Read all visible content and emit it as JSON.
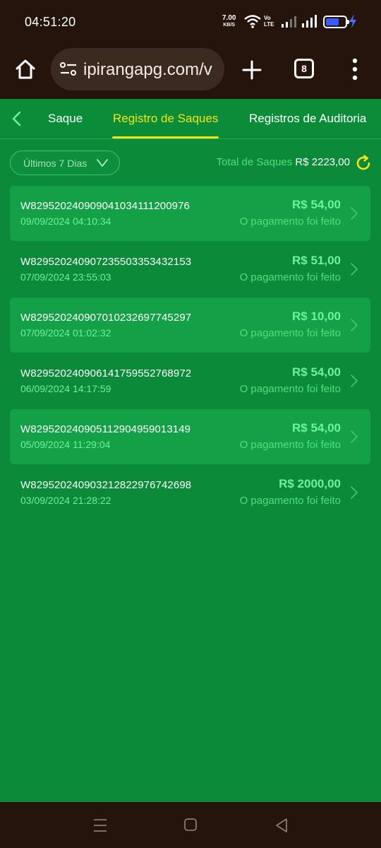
{
  "status": {
    "time": "04:51:20",
    "net_speed": "7.00",
    "net_unit": "KB/S",
    "volte_top": "Vo",
    "volte_bottom": "LTE",
    "icons": [
      "wifi-icon",
      "volte-icon",
      "signal-icon",
      "signal-icon",
      "battery-icon",
      "charging-icon"
    ]
  },
  "browser": {
    "url": "ipirangapg.com/v",
    "tab_count": "8",
    "icons": [
      "home-icon",
      "site-settings-icon",
      "plus-icon",
      "tab-switcher-icon",
      "more-vert-icon"
    ]
  },
  "nav": {
    "back_icon": "chevron-left-icon",
    "tabs": [
      {
        "label": "Saque",
        "active": false
      },
      {
        "label": "Registro de Saques",
        "active": true
      },
      {
        "label": "Registros de Auditoria",
        "active": false
      }
    ]
  },
  "filter": {
    "label": "Últimos 7 Dias",
    "icon": "chevron-down-icon"
  },
  "summary": {
    "label": "Total de Saques",
    "amount": "R$ 2223,00",
    "icon": "refresh-icon"
  },
  "records": [
    {
      "id": "W829520240909041034111200976",
      "date": "09/09/2024 04:10:34",
      "amount": "R$ 54,00",
      "status": "O pagamento foi feito"
    },
    {
      "id": "W829520240907235503353432153",
      "date": "07/09/2024 23:55:03",
      "amount": "R$ 51,00",
      "status": "O pagamento foi feito"
    },
    {
      "id": "W829520240907010232697745297",
      "date": "07/09/2024 01:02:32",
      "amount": "R$ 10,00",
      "status": "O pagamento foi feito"
    },
    {
      "id": "W829520240906141759552768972",
      "date": "06/09/2024 14:17:59",
      "amount": "R$ 54,00",
      "status": "O pagamento foi feito"
    },
    {
      "id": "W829520240905112904959013149",
      "date": "05/09/2024 11:29:04",
      "amount": "R$ 54,00",
      "status": "O pagamento foi feito"
    },
    {
      "id": "W829520240903212822976742698",
      "date": "03/09/2024 21:28:22",
      "amount": "R$ 2000,00",
      "status": "O pagamento foi feito"
    }
  ],
  "system_nav": {
    "icons": [
      "recents-icon",
      "home-icon",
      "back-icon"
    ]
  },
  "colors": {
    "background": "#0b8a3a",
    "row_highlight": "#13a046",
    "active_tab": "#f3e41a",
    "accent_green": "#6ff29a",
    "system_bar": "#24140c"
  }
}
